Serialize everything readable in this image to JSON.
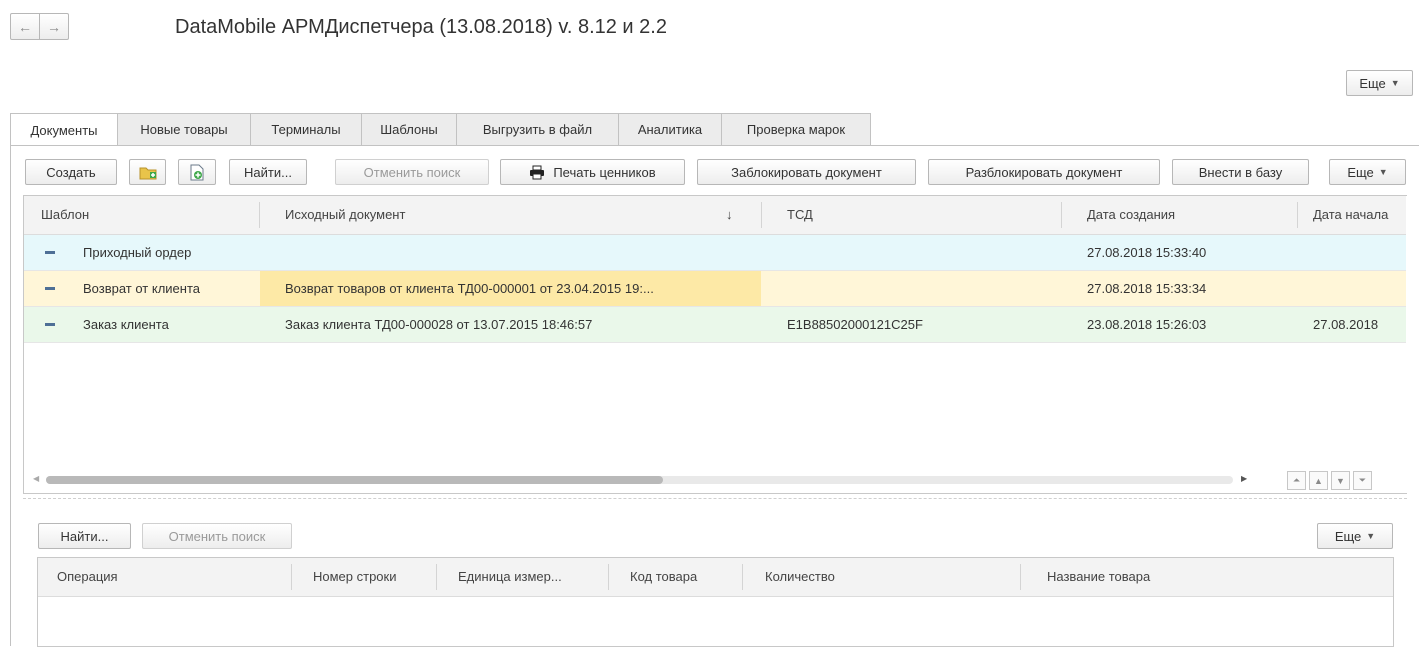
{
  "title": "DataMobile АРМДиспетчера (13.08.2018) v. 8.12 и 2.2",
  "nav": {
    "back_icon": "arrow-left-icon",
    "forward_icon": "arrow-right-icon"
  },
  "more_label": "Еще",
  "tabs": [
    {
      "label": "Документы",
      "active": true
    },
    {
      "label": "Новые товары"
    },
    {
      "label": "Терминалы"
    },
    {
      "label": "Шаблоны"
    },
    {
      "label": "Выгрузить в файл"
    },
    {
      "label": "Аналитика"
    },
    {
      "label": "Проверка марок"
    }
  ],
  "toolbar": {
    "create": "Создать",
    "create_folder_icon": "folder-add-icon",
    "copy_icon": "document-add-icon",
    "find": "Найти...",
    "cancel_search": "Отменить поиск",
    "print_icon": "printer-icon",
    "print_prices": "Печать ценников",
    "lock_doc": "Заблокировать документ",
    "unlock_doc": "Разблокировать документ",
    "to_base": "Внести в базу",
    "more": "Еще"
  },
  "grid": {
    "columns": [
      "Шаблон",
      "Исходный документ",
      "ТСД",
      "Дата создания",
      "Дата начала"
    ],
    "sort_indicator": "↓",
    "rows": [
      {
        "template": "Приходный ордер",
        "source": "",
        "tsd": "",
        "created": "27.08.2018 15:33:40",
        "start": "",
        "bg": "#e6f8fb"
      },
      {
        "template": "Возврат от клиента",
        "source": "Возврат товаров от клиента ТД00-000001 от 23.04.2015 19:...",
        "tsd": "",
        "created": "27.08.2018 15:33:34",
        "start": "",
        "bg": "#fff6d8",
        "source_bg": "#fde9a6"
      },
      {
        "template": "Заказ клиента",
        "source": "Заказ клиента ТД00-000028 от 13.07.2015 18:46:57",
        "tsd": "E1B88502000121C25F",
        "created": "23.08.2018 15:26:03",
        "start": "27.08.2018",
        "bg": "#eaf8ea"
      }
    ]
  },
  "lower": {
    "find": "Найти...",
    "cancel_search": "Отменить поиск",
    "more": "Еще",
    "columns": [
      "Операция",
      "Номер строки",
      "Единица измер...",
      "Код товара",
      "Количество",
      "Название товара"
    ]
  }
}
